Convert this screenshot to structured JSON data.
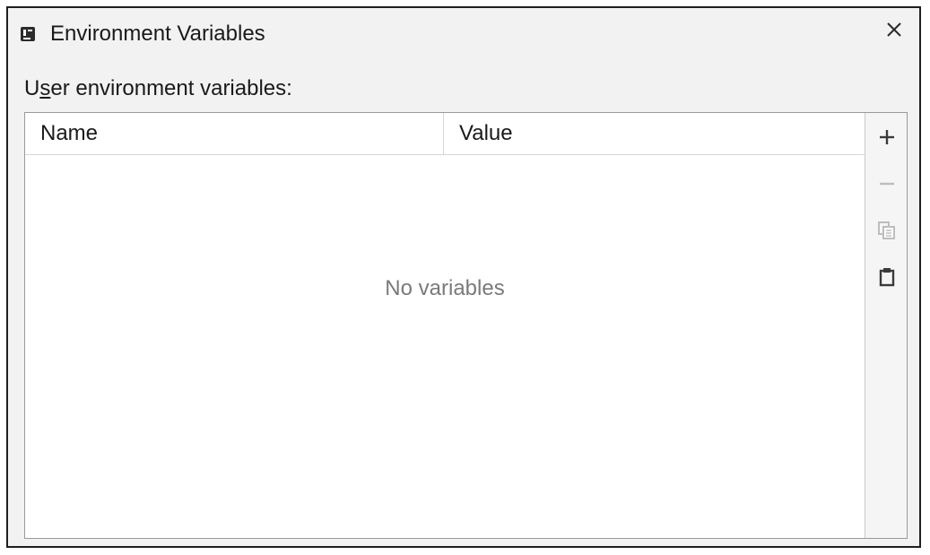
{
  "window": {
    "title": "Environment Variables",
    "app_icon": "intellij-app-icon",
    "close_icon": "close-icon"
  },
  "section": {
    "label_prefix": "U",
    "label_mnemonic": "s",
    "label_suffix": "er environment variables:"
  },
  "table": {
    "columns": [
      "Name",
      "Value"
    ],
    "rows": [],
    "empty_text": "No variables"
  },
  "toolbar": {
    "buttons": [
      {
        "name": "add",
        "icon": "plus-icon",
        "enabled": true
      },
      {
        "name": "remove",
        "icon": "minus-icon",
        "enabled": false
      },
      {
        "name": "copy",
        "icon": "copy-icon",
        "enabled": false
      },
      {
        "name": "paste",
        "icon": "paste-icon",
        "enabled": true
      }
    ]
  },
  "colors": {
    "dialog_bg": "#f2f2f2",
    "border": "#1f1f1f",
    "placeholder_text": "#7a7a7a",
    "disabled_icon": "#bdbdbd",
    "enabled_icon": "#3a3a3a"
  }
}
